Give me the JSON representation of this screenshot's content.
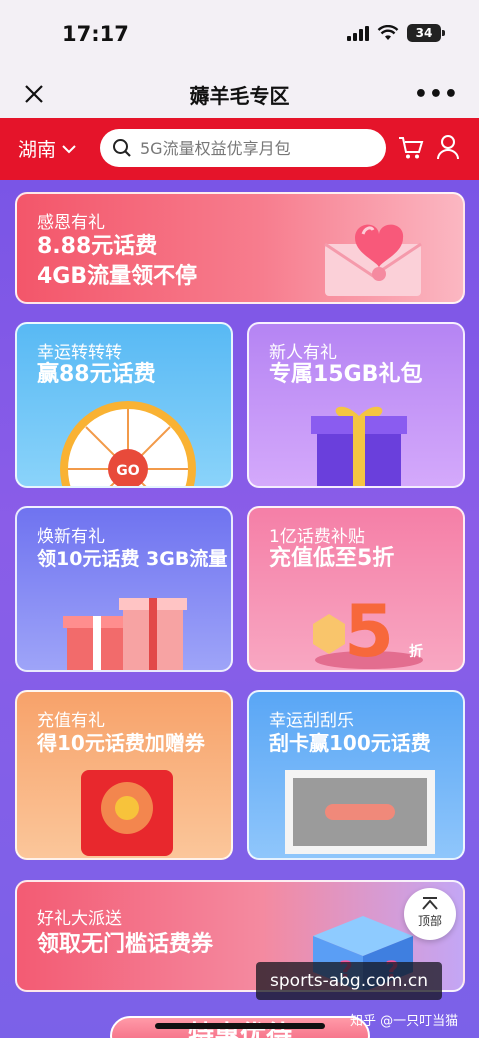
{
  "status_bar": {
    "time": "17:17",
    "battery": "34"
  },
  "nav": {
    "title": "薅羊毛专区"
  },
  "search": {
    "region": "湖南",
    "placeholder": "5G流量权益优享月包"
  },
  "cards": [
    {
      "title": "感恩有礼",
      "line1": "8.88元话费",
      "line2": "4GB流量领不停"
    },
    {
      "title": "幸运转转转",
      "line1": "赢88元话费",
      "wheel_label": "GO"
    },
    {
      "title": "新人有礼",
      "line1": "专属15GB礼包"
    },
    {
      "title": "焕新有礼",
      "line1": "领10元话费  3GB流量"
    },
    {
      "title": "1亿话费补贴",
      "line1": "充值低至5折",
      "badge_number": "5",
      "badge_unit": "折"
    },
    {
      "title": "充值有礼",
      "line1": "得10元话费加赠券"
    },
    {
      "title": "幸运刮刮乐",
      "line1": "刮卡赢100元话费"
    },
    {
      "title": "好礼大派送",
      "line1": "领取无门槛话费券"
    }
  ],
  "top_button": {
    "label": "顶部"
  },
  "watermark": {
    "text": "sports-abg.com.cn",
    "credit": "知乎 @一只叮当猫"
  },
  "bottom_button": {
    "label": "特惠优待"
  },
  "icons": [
    "close-icon",
    "more-icon",
    "chevron-down-icon",
    "search-icon",
    "cart-icon",
    "user-icon",
    "up-arrow-icon"
  ],
  "colors": {
    "header_red": "#e5142a",
    "background_purple": "#7c4fe0"
  }
}
